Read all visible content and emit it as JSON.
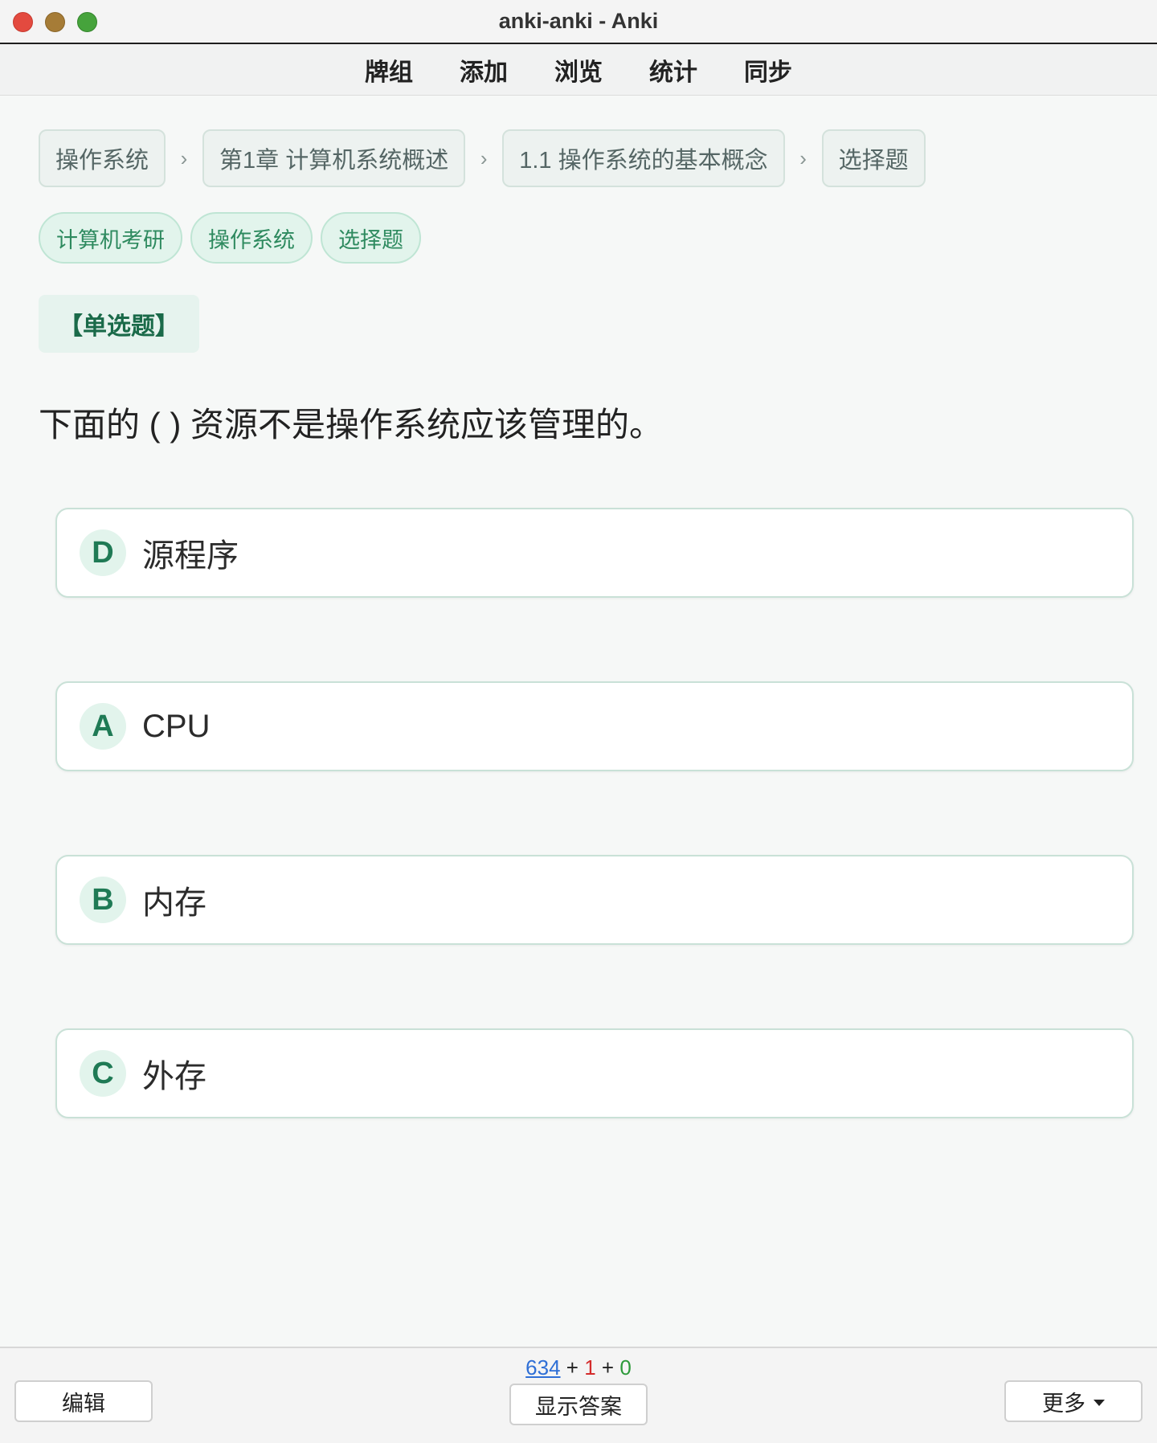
{
  "window": {
    "title": "anki-anki - Anki"
  },
  "toolbar": {
    "tabs": [
      "牌组",
      "添加",
      "浏览",
      "统计",
      "同步"
    ]
  },
  "card": {
    "breadcrumb": [
      "操作系统",
      "第1章 计算机系统概述",
      "1.1 操作系统的基本概念",
      "选择题"
    ],
    "breadcrumb_separator": "›",
    "tags": [
      "计算机考研",
      "操作系统",
      "选择题"
    ],
    "question_type": "【单选题】",
    "question": "下面的 ( ) 资源不是操作系统应该管理的。",
    "options": [
      {
        "letter": "D",
        "text": "源程序"
      },
      {
        "letter": "A",
        "text": "CPU"
      },
      {
        "letter": "B",
        "text": "内存"
      },
      {
        "letter": "C",
        "text": "外存"
      }
    ]
  },
  "bottom": {
    "counts": {
      "new": "634",
      "learn": "1",
      "review": "0",
      "plus": "+"
    },
    "edit_label": "编辑",
    "show_answer_label": "显示答案",
    "more_label": "更多"
  },
  "colors": {
    "accent": "#1f7a55",
    "tag_bg": "#e2f4ec",
    "count_new": "#2f6fd6",
    "count_learn": "#d42b2b",
    "count_review": "#2d9a3a"
  }
}
